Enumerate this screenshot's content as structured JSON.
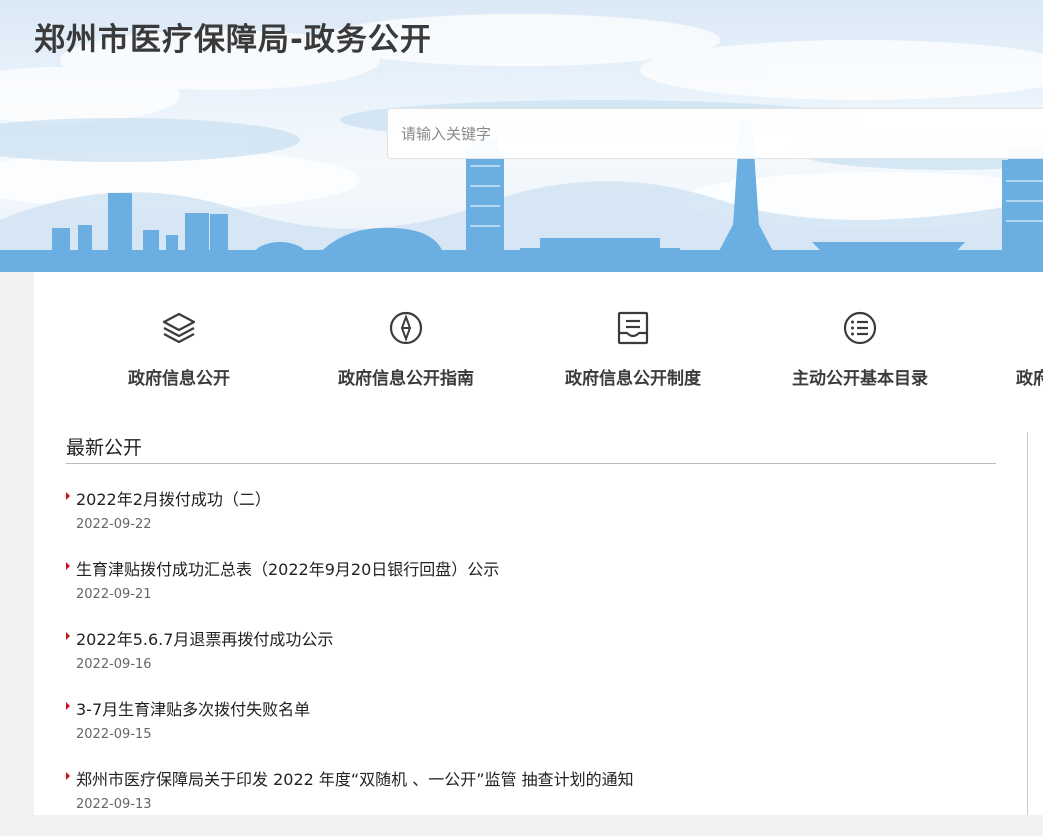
{
  "header": {
    "site_title": "郑州市医疗保障局-政务公开",
    "search_placeholder": "请输入关键字"
  },
  "quick_nav": [
    {
      "label": "政府信息公开",
      "icon": "layers-icon"
    },
    {
      "label": "政府信息公开指南",
      "icon": "compass-icon"
    },
    {
      "label": "政府信息公开制度",
      "icon": "inbox-icon"
    },
    {
      "label": "主动公开基本目录",
      "icon": "list-icon"
    },
    {
      "label": "政府",
      "icon": "truncated"
    }
  ],
  "latest": {
    "title": "最新公开",
    "items": [
      {
        "title": "2022年2月拨付成功（二）",
        "date": "2022-09-22"
      },
      {
        "title": "生育津贴拨付成功汇总表（2022年9月20日银行回盘）公示",
        "date": "2022-09-21"
      },
      {
        "title": "2022年5.6.7月退票再拨付成功公示",
        "date": "2022-09-16"
      },
      {
        "title": "3-7月生育津贴多次拨付失败名单",
        "date": "2022-09-15"
      },
      {
        "title": "郑州市医疗保障局关于印发 2022 年度“双随机 、一公开”监管 抽查计划的通知",
        "date": "2022-09-13"
      }
    ]
  },
  "colors": {
    "accent_red": "#c8161d",
    "skyline_blue": "#6aaee2"
  }
}
